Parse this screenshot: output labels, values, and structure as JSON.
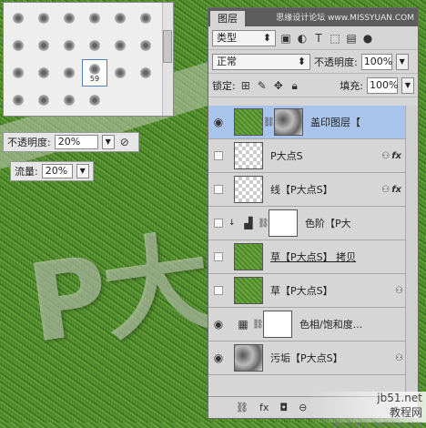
{
  "canvas": {
    "big_text": "P大"
  },
  "brush_picker": {
    "selected_size": "59"
  },
  "options": {
    "opacity_label": "不透明度:",
    "opacity_value": "20%",
    "flow_label": "流量:",
    "flow_value": "20%"
  },
  "layers_panel": {
    "tab": "图层",
    "watermark": "思缘设计论坛 www.MISSYUAN.COM",
    "filter_kind": "类型",
    "blend_mode": "正常",
    "opacity_label": "不透明度:",
    "opacity_value": "100%",
    "lock_label": "锁定:",
    "fill_label": "填充:",
    "fill_value": "100%",
    "layers": [
      {
        "name": "盖印图层【",
        "thumb": "grass",
        "visible": true,
        "active": true,
        "mask": true
      },
      {
        "name": "P大点S",
        "thumb": "trans",
        "visible": false,
        "fx": true
      },
      {
        "name": "线【P大点S】",
        "thumb": "trans",
        "visible": false,
        "fx": true
      },
      {
        "name": "色阶【P大",
        "thumb": "white",
        "visible": false,
        "adjust": true
      },
      {
        "name": "草【P大点S】 拷贝",
        "thumb": "grass",
        "visible": false,
        "underline": true
      },
      {
        "name": "草【P大点S】",
        "thumb": "grass",
        "visible": false,
        "fx": true
      },
      {
        "name": "色相/饱和度...",
        "thumb": "white",
        "visible": true,
        "adjust": true
      },
      {
        "name": "污垢【P大点S】",
        "thumb": "noise",
        "visible": true,
        "fx": true
      }
    ],
    "footer": {
      "fx": "fx",
      "link": "⊖"
    }
  },
  "corner_watermark": {
    "site": "jb51.net",
    "text": "教程网",
    "url": "jiaocheng.chazidian.com"
  }
}
